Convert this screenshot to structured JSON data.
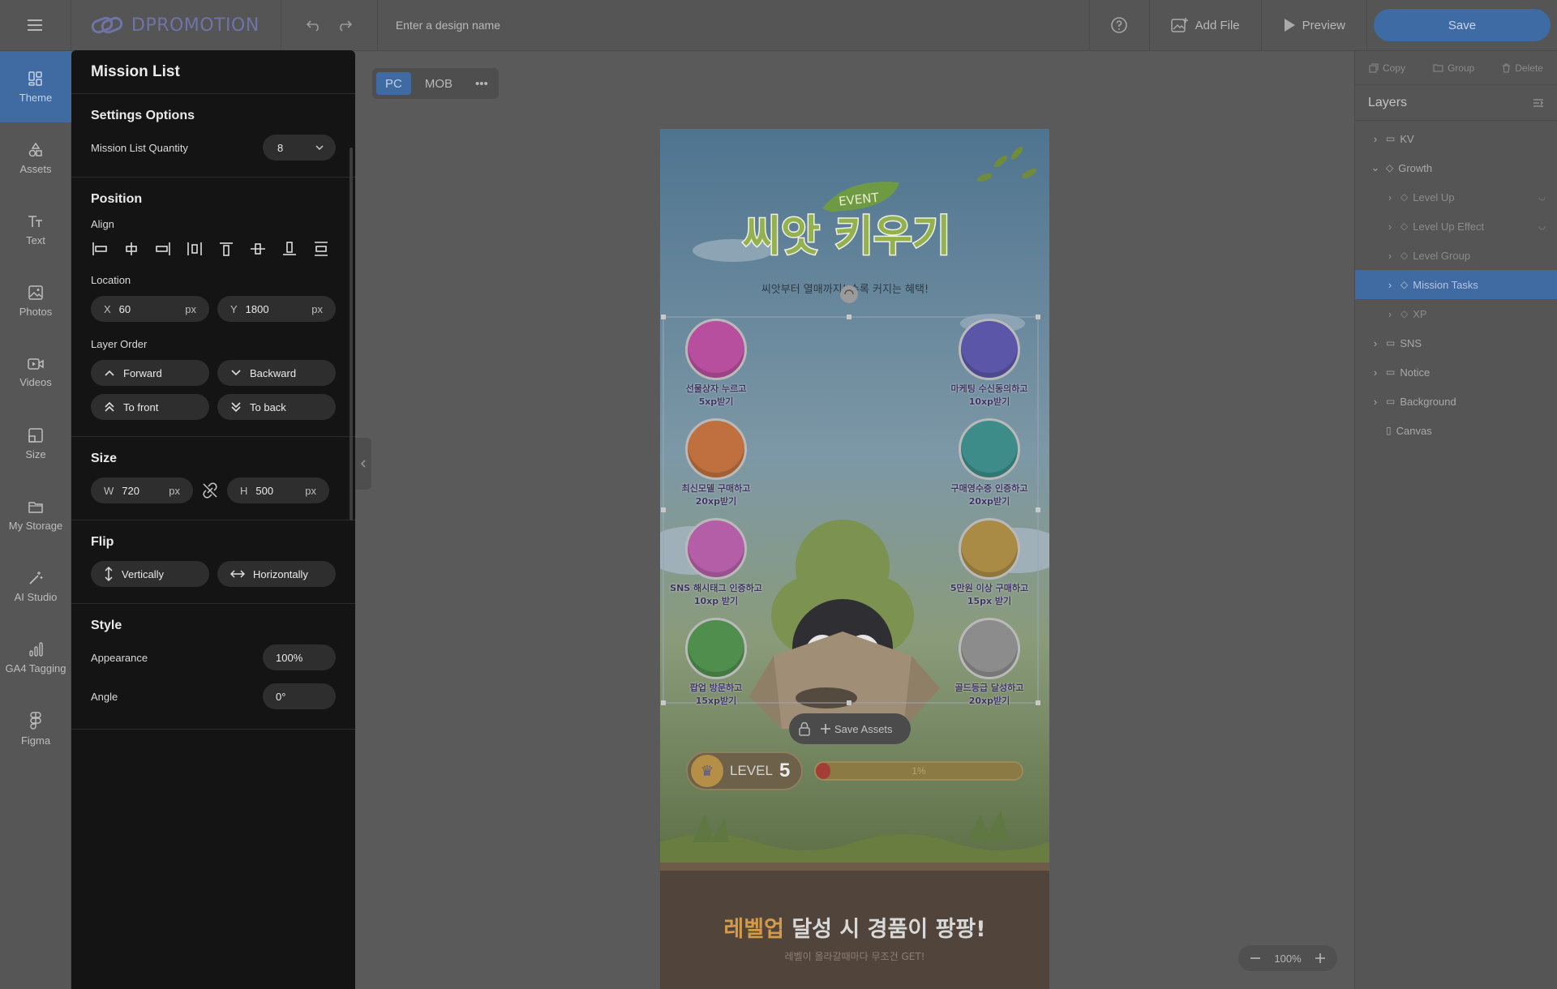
{
  "topbar": {
    "logo_text": "DPROMOTION",
    "design_name_placeholder": "Enter a design name",
    "add_file_label": "Add File",
    "preview_label": "Preview",
    "save_label": "Save"
  },
  "rail": {
    "items": [
      {
        "label": "Theme",
        "icon": "theme-icon"
      },
      {
        "label": "Assets",
        "icon": "assets-icon"
      },
      {
        "label": "Text",
        "icon": "text-icon"
      },
      {
        "label": "Photos",
        "icon": "photos-icon"
      },
      {
        "label": "Videos",
        "icon": "videos-icon"
      },
      {
        "label": "Size",
        "icon": "size-icon"
      },
      {
        "label": "My Storage",
        "icon": "folder-icon"
      },
      {
        "label": "AI Studio",
        "icon": "magic-wand-icon"
      },
      {
        "label": "GA4 Tagging",
        "icon": "analytics-icon"
      },
      {
        "label": "Figma",
        "icon": "figma-icon"
      }
    ]
  },
  "panel": {
    "title": "Mission List",
    "settings": {
      "heading": "Settings Options",
      "quantity_label": "Mission List Quantity",
      "quantity_value": "8"
    },
    "position": {
      "heading": "Position",
      "align_label": "Align",
      "location_label": "Location",
      "x_axis": "X",
      "x_value": "60",
      "x_unit": "px",
      "y_axis": "Y",
      "y_value": "1800",
      "y_unit": "px",
      "layer_order_label": "Layer Order",
      "forward": "Forward",
      "backward": "Backward",
      "to_front": "To front",
      "to_back": "To back"
    },
    "size": {
      "heading": "Size",
      "w_axis": "W",
      "w_value": "720",
      "w_unit": "px",
      "h_axis": "H",
      "h_value": "500",
      "h_unit": "px"
    },
    "flip": {
      "heading": "Flip",
      "vertically": "Vertically",
      "horizontally": "Horizontally"
    },
    "style": {
      "heading": "Style",
      "appearance_label": "Appearance",
      "appearance_value": "100%",
      "angle_label": "Angle",
      "angle_value": "0°"
    }
  },
  "view_toggle": {
    "pc": "PC",
    "mob": "MOB"
  },
  "artboard": {
    "event_badge": "EVENT",
    "title": "씨앗 키우기",
    "subtitle": "씨앗부터 열매까지! 수록 커지는 혜택!",
    "missions_left": [
      {
        "line1": "선물상자 누르고",
        "line2": "5xp받기",
        "color": "#b74f9e",
        "icon": "treasure-chest-icon"
      },
      {
        "line1": "최신모델 구매하고",
        "line2": "20xp받기",
        "color": "#c0703e",
        "icon": "shopping-bag-icon"
      },
      {
        "line1": "SNS 해시태그 인증하고",
        "line2": "10xp 받기",
        "color": "#b45ea8",
        "icon": "book-icon"
      },
      {
        "line1": "팝업 방문하고",
        "line2": "15xp받기",
        "color": "#4f8e4c",
        "icon": "lightning-icon"
      }
    ],
    "missions_right": [
      {
        "line1": "마케팅 수신동의하고",
        "line2": "10xp받기",
        "color": "#5b56a8",
        "icon": "lock-icon"
      },
      {
        "line1": "구매영수증 인증하고",
        "line2": "20xp받기",
        "color": "#3d8c8a",
        "icon": "gift-icon"
      },
      {
        "line1": "5만원 이상 구매하고",
        "line2": "15px 받기",
        "color": "#a98b46",
        "icon": "star-coin-icon"
      },
      {
        "line1": "골드등급 달성하고",
        "line2": "20xp받기",
        "color": "#8c8c8c",
        "icon": "gem-icon"
      }
    ],
    "save_assets": "Save Assets",
    "level_label": "LEVEL",
    "level_number": "5",
    "progress_text": "1%",
    "progress": 0.01,
    "bottom_highlight": "레벨업",
    "bottom_rest": " 달성 시 경품이 팡팡!",
    "bottom_sub": "레벨이 올라갈때마다 무조건 GET!"
  },
  "zoom": {
    "value": "100%"
  },
  "right_panel": {
    "copy": "Copy",
    "group": "Group",
    "delete": "Delete",
    "layers_title": "Layers",
    "layers": [
      {
        "label": "KV",
        "level": 0,
        "icon": "folder-icon"
      },
      {
        "label": "Growth",
        "level": 0,
        "icon": "sparkle-icon",
        "open": true
      },
      {
        "label": "Level Up",
        "level": 1,
        "icon": "arrow-up-icon"
      },
      {
        "label": "Level Up Effect",
        "level": 1,
        "icon": "effect-icon"
      },
      {
        "label": "Level Group",
        "level": 1,
        "icon": "group-icon"
      },
      {
        "label": "Mission Tasks",
        "level": 1,
        "icon": "list-icon",
        "selected": true
      },
      {
        "label": "XP",
        "level": 1,
        "icon": "xp-icon"
      },
      {
        "label": "SNS",
        "level": 0,
        "icon": "folder-icon"
      },
      {
        "label": "Notice",
        "level": 0,
        "icon": "folder-icon"
      },
      {
        "label": "Background",
        "level": 0,
        "icon": "folder-icon"
      },
      {
        "label": "Canvas",
        "level": 0,
        "icon": "canvas-icon"
      }
    ]
  },
  "colors": {
    "accent": "#3f6aa2",
    "panel_bg": "#141414",
    "chrome_bg": "#555555"
  }
}
